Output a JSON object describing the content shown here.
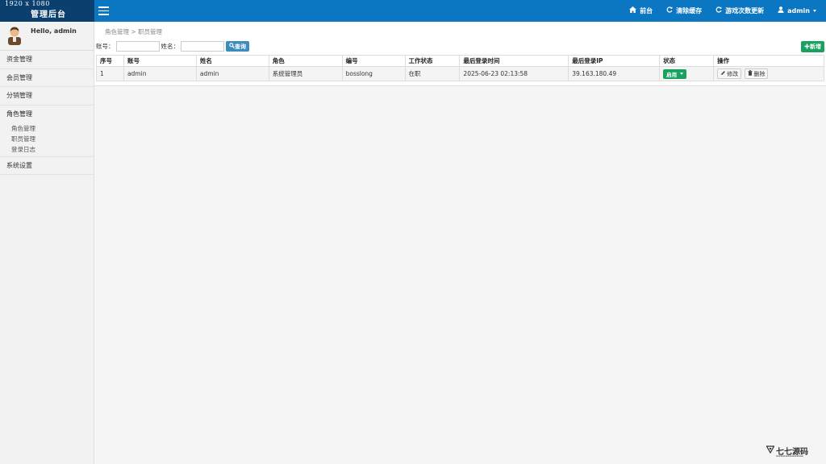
{
  "brand": {
    "resolution": "1920 x 1080",
    "system_title": "管理后台"
  },
  "topnav": [
    {
      "label": "前台",
      "icon": "home-icon"
    },
    {
      "label": "清除缓存",
      "icon": "refresh-icon"
    },
    {
      "label": "游戏次数更新",
      "icon": "refresh-icon"
    },
    {
      "label": "admin",
      "icon": "user-icon"
    }
  ],
  "sidebar": {
    "greeting": "Hello, admin",
    "items": [
      "资金管理",
      "会员管理",
      "分销管理"
    ],
    "active_group": {
      "title": "角色管理",
      "subitems": [
        "角色管理",
        "职员管理",
        "登录日志"
      ]
    },
    "last_item": "系统设置"
  },
  "breadcrumb": "角色管理 > 职员管理",
  "search": {
    "account_label": "账号：",
    "name_label": "姓名：",
    "query_button": "查询",
    "account_value": "",
    "name_value": ""
  },
  "add_button": "新增",
  "table": {
    "headers": [
      "序号",
      "账号",
      "姓名",
      "角色",
      "编号",
      "工作状态",
      "最后登录时间",
      "最后登录IP",
      "状态",
      "操作"
    ],
    "rows": [
      {
        "no": "1",
        "account": "admin",
        "name": "admin",
        "role": "系统管理员",
        "code": "bosslong",
        "work_status": "在职",
        "last_login_time": "2025-06-23 02:13:58",
        "last_login_ip": "39.163.180.49",
        "status": "启用",
        "edit": "修改",
        "delete": "删除"
      }
    ]
  },
  "watermark": {
    "title": "七七源码"
  },
  "colors": {
    "topbar": "#0b76c2",
    "brand_bg": "#0a3f6e",
    "primary": "#3c8dbc",
    "success": "#18a15f"
  }
}
